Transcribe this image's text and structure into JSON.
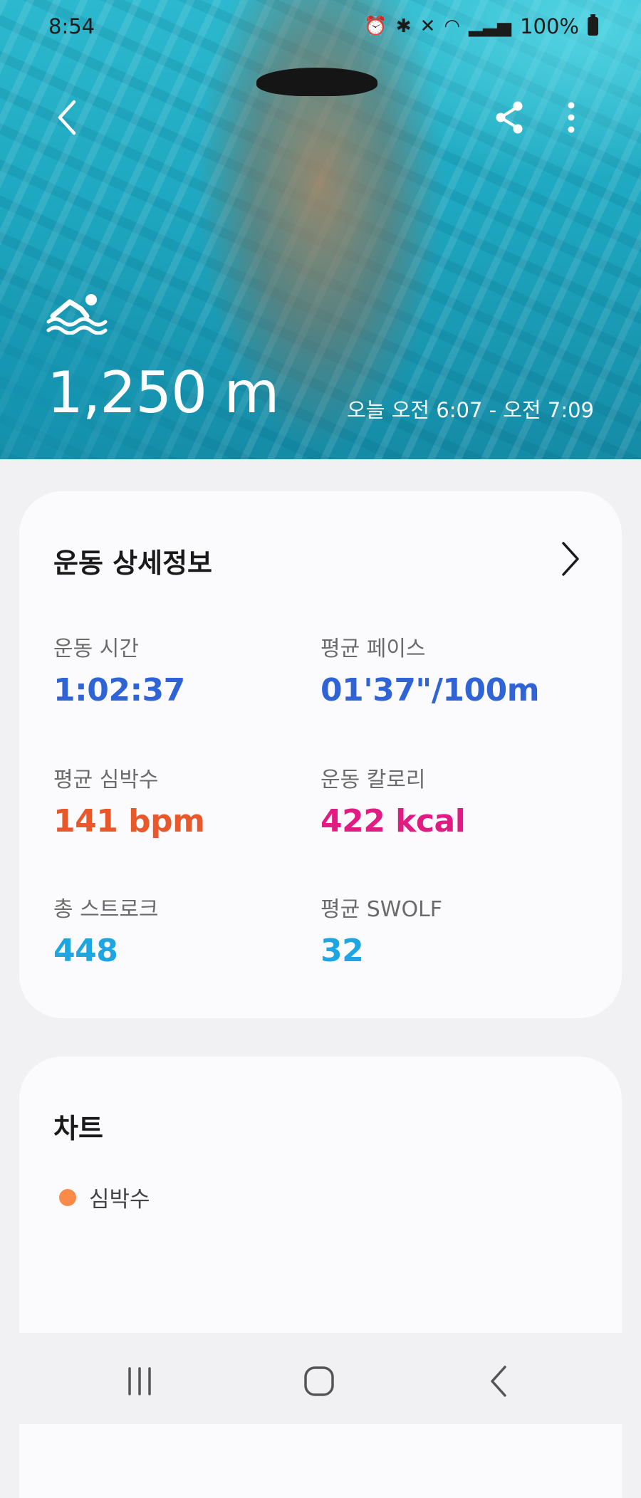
{
  "status_bar": {
    "time": "8:54",
    "battery": "100%",
    "icons": [
      "alarm-icon",
      "bluetooth-icon",
      "vibrate-icon",
      "wifi-icon",
      "signal-icon",
      "battery-icon"
    ]
  },
  "hero": {
    "activity_icon": "swimming-icon",
    "distance": "1,250 m",
    "time_range": "오늘 오전 6:07 - 오전 7:09"
  },
  "toolbar": {
    "back_icon": "back-icon",
    "share_icon": "share-icon",
    "more_icon": "more-options-icon"
  },
  "details": {
    "title": "운동 상세정보",
    "stats": [
      {
        "label": "운동 시간",
        "value": "1:02:37",
        "color": "#2f63d6"
      },
      {
        "label": "평균 페이스",
        "value": "01'37\"/100m",
        "color": "#2f63d6"
      },
      {
        "label": "평균 심박수",
        "value": "141 bpm",
        "color": "#e8582a"
      },
      {
        "label": "운동 칼로리",
        "value": "422 kcal",
        "color": "#e01b82"
      },
      {
        "label": "총 스트로크",
        "value": "448",
        "color": "#1ea6e2"
      },
      {
        "label": "평균 SWOLF",
        "value": "32",
        "color": "#1ea6e2"
      }
    ]
  },
  "chart": {
    "title": "차트",
    "legend_label": "심박수",
    "legend_color": "#fa8a48"
  },
  "nav": {
    "recent_icon": "recent-apps-icon",
    "home_icon": "home-icon",
    "back_icon": "back-icon"
  }
}
